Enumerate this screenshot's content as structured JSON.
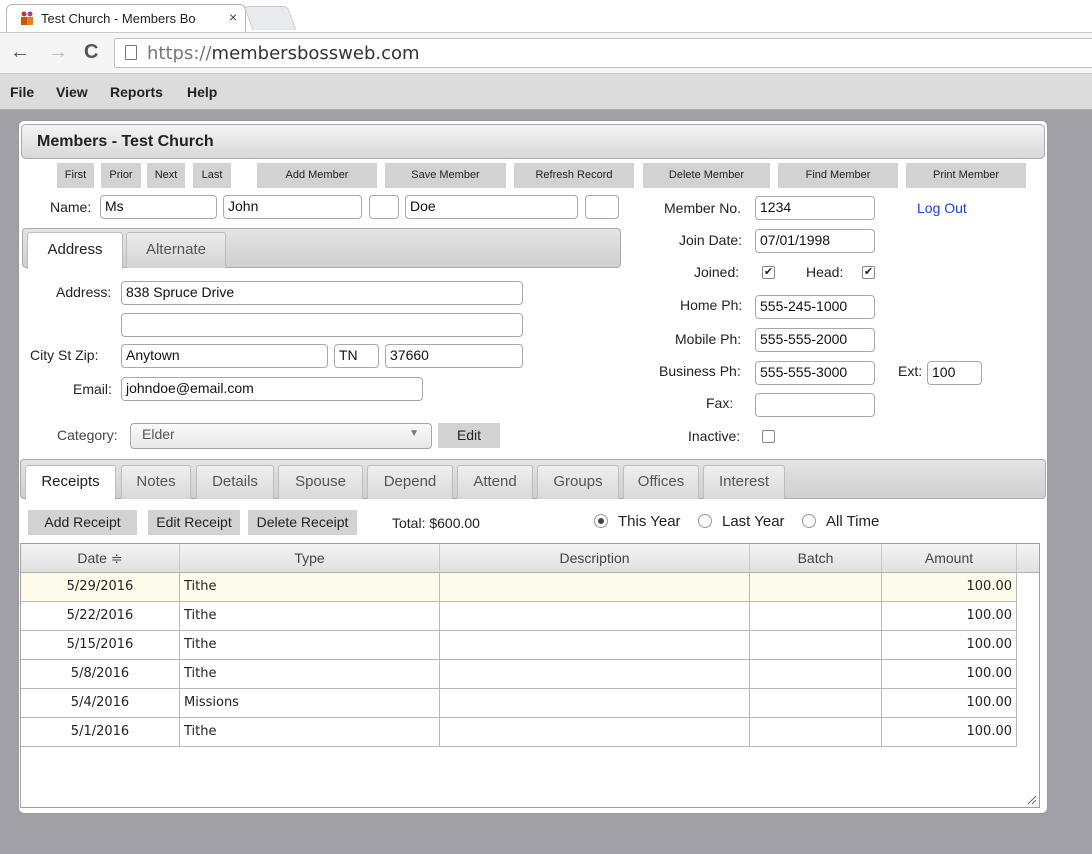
{
  "browser": {
    "tab_title": "Test Church - Members Bo",
    "tab_close": "×",
    "url_scheme": "https://",
    "url_host": "membersbossweb.com"
  },
  "menu": [
    "File",
    "View",
    "Reports",
    "Help"
  ],
  "window": {
    "title": "Members - Test Church"
  },
  "toolbar": {
    "first": "First",
    "prior": "Prior",
    "next": "Next",
    "last": "Last",
    "add": "Add Member",
    "save": "Save Member",
    "refresh": "Refresh Record",
    "delete": "Delete Member",
    "find": "Find Member",
    "print": "Print Member"
  },
  "member": {
    "name_label": "Name:",
    "title": "Ms",
    "first": "John",
    "middle": "",
    "last": "Doe",
    "suffix": "",
    "member_no_label": "Member No.",
    "member_no": "1234",
    "logout": "Log Out",
    "join_date_label": "Join Date:",
    "join_date": "07/01/1998",
    "joined_label": "Joined:",
    "joined": true,
    "head_label": "Head:",
    "head": true,
    "home_label": "Home Ph:",
    "home": "555-245-1000",
    "mobile_label": "Mobile Ph:",
    "mobile": "555-555-2000",
    "business_label": "Business Ph:",
    "business": "555-555-3000",
    "ext_label": "Ext:",
    "ext": "100",
    "fax_label": "Fax:",
    "fax": "",
    "inactive_label": "Inactive:",
    "inactive": false
  },
  "address_tabs": [
    "Address",
    "Alternate"
  ],
  "address": {
    "address_label": "Address:",
    "line1": "838 Spruce Drive",
    "line2": "",
    "csz_label": "City St Zip:",
    "city": "Anytown",
    "state": "TN",
    "zip": "37660",
    "email_label": "Email:",
    "email": "johndoe@email.com",
    "category_label": "Category:",
    "category": "Elder",
    "edit": "Edit"
  },
  "detail_tabs": [
    "Receipts",
    "Notes",
    "Details",
    "Spouse",
    "Depend",
    "Attend",
    "Groups",
    "Offices",
    "Interest"
  ],
  "receipts": {
    "add": "Add Receipt",
    "edit": "Edit Receipt",
    "delete": "Delete Receipt",
    "total": "Total: $600.00",
    "range_options": [
      "This Year",
      "Last Year",
      "All Time"
    ],
    "range_selected": "This Year",
    "columns": [
      "Date ≑",
      "Type",
      "Description",
      "Batch",
      "Amount"
    ],
    "rows": [
      [
        "5/29/2016",
        "Tithe",
        "",
        "",
        "100.00"
      ],
      [
        "5/22/2016",
        "Tithe",
        "",
        "",
        "100.00"
      ],
      [
        "5/15/2016",
        "Tithe",
        "",
        "",
        "100.00"
      ],
      [
        "5/8/2016",
        "Tithe",
        "",
        "",
        "100.00"
      ],
      [
        "5/4/2016",
        "Missions",
        "",
        "",
        "100.00"
      ],
      [
        "5/1/2016",
        "Tithe",
        "",
        "",
        "100.00"
      ]
    ]
  },
  "colors": {
    "background": "#a0a0a6",
    "button": "#d2d2d2",
    "link": "#1a3fd8",
    "selected_row": "#fffbea"
  }
}
